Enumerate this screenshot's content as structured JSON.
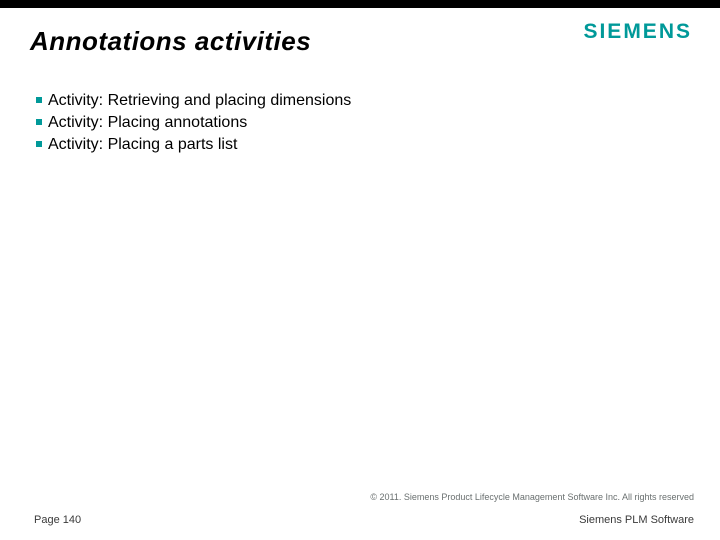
{
  "header": {
    "title": "Annotations activities",
    "brand": "SIEMENS"
  },
  "content": {
    "bullets": [
      "Activity: Retrieving and placing dimensions",
      "Activity: Placing annotations",
      "Activity: Placing a parts list"
    ]
  },
  "footer": {
    "copyright": "© 2011. Siemens Product Lifecycle Management Software Inc. All rights reserved",
    "page": "Page 140",
    "right": "Siemens PLM Software"
  }
}
